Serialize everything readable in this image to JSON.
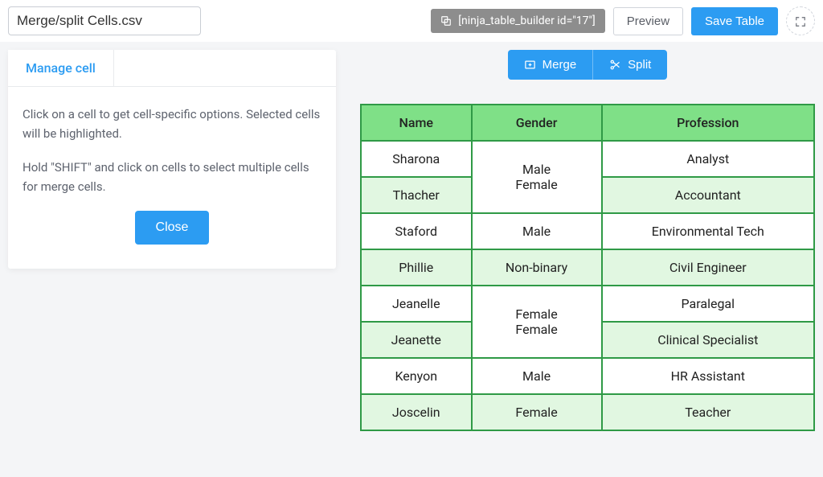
{
  "header": {
    "title_value": "Merge/split Cells.csv",
    "shortcode": "[ninja_table_builder id=\"17\"]",
    "preview_label": "Preview",
    "save_label": "Save Table"
  },
  "panel": {
    "tab_label": "Manage cell",
    "help_text_1": "Click on a cell to get cell-specific options. Selected cells will be highlighted.",
    "help_text_2": "Hold \"SHIFT\" and click on cells to select multiple cells for merge cells.",
    "close_label": "Close"
  },
  "table_actions": {
    "merge_label": "Merge",
    "split_label": "Split"
  },
  "table": {
    "headers": [
      "Name",
      "Gender",
      "Profession"
    ],
    "rows": [
      {
        "name": "Sharona",
        "merged_gender": "Male\nFemale",
        "profession": "Analyst",
        "stripe": false,
        "gender_rowspan": 2
      },
      {
        "name": "Thacher",
        "profession": "Accountant",
        "stripe": true
      },
      {
        "name": "Staford",
        "gender": "Male",
        "profession": "Environmental Tech",
        "stripe": false
      },
      {
        "name": "Phillie",
        "gender": "Non-binary",
        "profession": "Civil Engineer",
        "stripe": true
      },
      {
        "name": "Jeanelle",
        "merged_gender": "Female\nFemale",
        "profession": "Paralegal",
        "stripe": false,
        "gender_rowspan": 2
      },
      {
        "name": "Jeanette",
        "profession": "Clinical Specialist",
        "stripe": true
      },
      {
        "name": "Kenyon",
        "gender": "Male",
        "profession": "HR Assistant",
        "stripe": false
      },
      {
        "name": "Joscelin",
        "gender": "Female",
        "profession": "Teacher",
        "stripe": true
      }
    ]
  }
}
